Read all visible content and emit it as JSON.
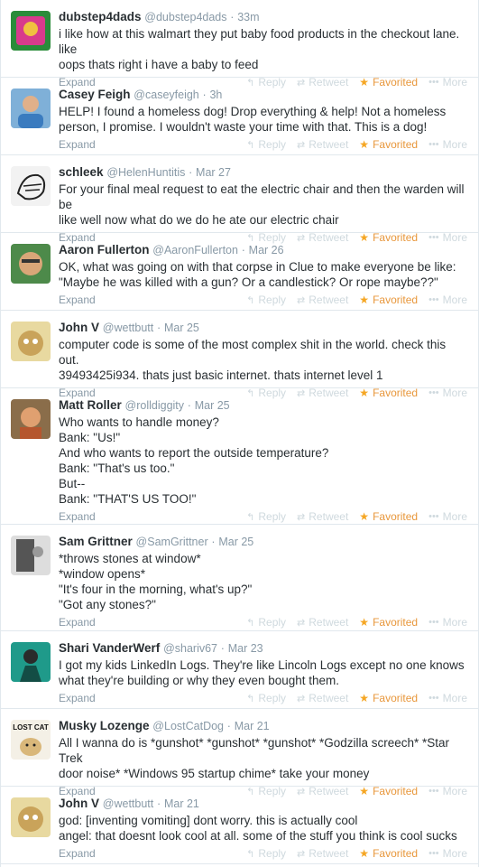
{
  "common": {
    "expand": "Expand",
    "reply": "Reply",
    "retweet": "Retweet",
    "favorited": "Favorited",
    "more": "More"
  },
  "tweets": [
    {
      "name": "dubstep4dads",
      "handle": "@dubstep4dads",
      "time": "33m",
      "text": "i like how at this walmart they put baby food products in the checkout lane. like\noops thats right i have a baby to feed",
      "avatar_color": "#2a8c3a"
    },
    {
      "name": "Casey Feigh",
      "handle": "@caseyfeigh",
      "time": "3h",
      "text": "HELP! I found a homeless dog! Drop everything & help! Not a homeless\nperson, I promise. I wouldn't waste your time with that. This is a dog!",
      "avatar_color": "#3a7bbf"
    },
    {
      "name": "schleek",
      "handle": "@HelenHuntitis",
      "time": "Mar 27",
      "text": "For your final meal request to eat the electric chair and then the warden will be\nlike well now what do we do he ate our electric chair",
      "avatar_color": "#e8e8e8"
    },
    {
      "name": "Aaron Fullerton",
      "handle": "@AaronFullerton",
      "time": "Mar 26",
      "text": "OK, what was going on with that corpse in Clue to make everyone be like:\n\"Maybe he was killed with a gun? Or a candlestick? Or rope maybe??\"",
      "avatar_color": "#4d8a4a"
    },
    {
      "name": "John V",
      "handle": "@wettbutt",
      "time": "Mar 25",
      "text": "computer code is some of the most complex shit in the world. check this out.\n39493425i934. thats just basic internet. thats internet level 1",
      "avatar_color": "#c9a35a"
    },
    {
      "name": "Matt Roller",
      "handle": "@rolldiggity",
      "time": "Mar 25",
      "text": "Who wants to handle money?\nBank: \"Us!\"\nAnd who wants to report the outside temperature?\nBank: \"That's us too.\"\nBut--\nBank: \"THAT'S US TOO!\"",
      "avatar_color": "#b5562e"
    },
    {
      "name": "Sam Grittner",
      "handle": "@SamGrittner",
      "time": "Mar 25",
      "text": "*throws stones at window*\n*window opens*\n\"It's four in the morning, what's up?\"\n\"Got any stones?\"",
      "avatar_color": "#6a6a6a"
    },
    {
      "name": "Shari VanderWerf",
      "handle": "@shariv67",
      "time": "Mar 23",
      "text": "I got my kids LinkedIn Logs. They're like Lincoln Logs except no one knows\nwhat they're building or why they even bought them.",
      "avatar_color": "#1f9a8a"
    },
    {
      "name": "Musky Lozenge",
      "handle": "@LostCatDog",
      "time": "Mar 21",
      "text": "All I wanna do is *gunshot* *gunshot* *gunshot* *Godzilla screech* *Star Trek\ndoor noise* *Windows 95 startup chime* take your money",
      "avatar_color": "#d9b77a",
      "avatar_text": "LOST CAT"
    },
    {
      "name": "John V",
      "handle": "@wettbutt",
      "time": "Mar 21",
      "text": "god: [inventing vomiting] dont worry. this is actually cool\nangel: that doesnt look cool at all. some of the stuff you think is cool sucks",
      "avatar_color": "#c9a35a"
    }
  ]
}
